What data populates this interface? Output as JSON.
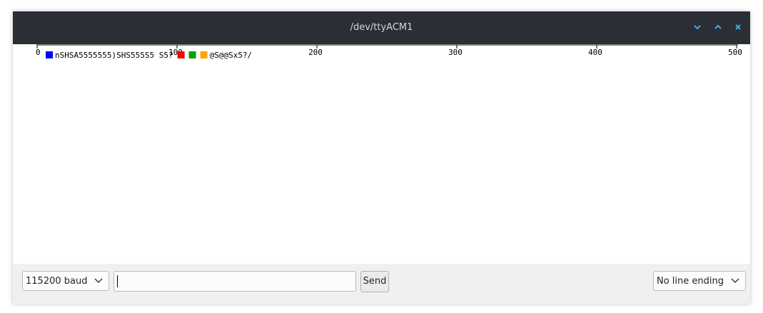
{
  "window": {
    "title": "/dev/ttyACM1",
    "icons": {
      "minimize": "chevron-down-icon",
      "maximize": "chevron-up-icon",
      "close": "close-icon"
    },
    "accent_color": "#3daee9",
    "titlebar_color": "#2b2e35"
  },
  "chart_data": {
    "type": "line",
    "x_ticks": [
      "0",
      "100",
      "200",
      "300",
      "400",
      "500"
    ],
    "xlim": [
      0,
      500
    ],
    "grid": false,
    "legend_placement": "top-left",
    "series": [
      {
        "name": "nSHSA5555555)SHS555S5 S5?",
        "color": "#0000ff",
        "values": []
      },
      {
        "name": "",
        "color": "#ff0000",
        "values": []
      },
      {
        "name": "",
        "color": "#00a000",
        "values": []
      },
      {
        "name": "@S@@Sx5?/",
        "color": "#ffa500",
        "values": []
      }
    ]
  },
  "bottom_bar": {
    "baud_select": {
      "selected": "115200 baud"
    },
    "message_input": {
      "value": ""
    },
    "send_label": "Send",
    "line_ending_select": {
      "selected": "No line ending"
    }
  }
}
